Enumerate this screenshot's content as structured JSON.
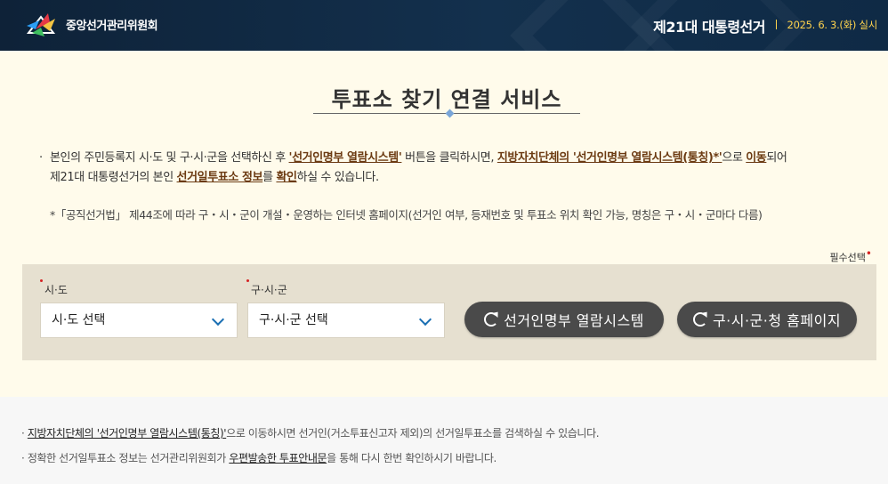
{
  "header": {
    "org_name": "중앙선거관리위원회",
    "election_title": "제21대 대통령선거",
    "election_date": "2025. 6. 3.(화) 실시"
  },
  "main": {
    "title": "투표소 찾기 연결 서비스",
    "desc": {
      "part1": "본인의 주민등록지 시·도 및 구·시·군을 선택하신 후 ",
      "hl1": "'선거인명부 열람시스템'",
      "part2": " 버튼을 클릭하시면, ",
      "hl2": "지방자치단체의 '선거인명부 열람시스템(통칭)*'",
      "part3": "으로 ",
      "hl3": "이동",
      "part4": "되어",
      "part5": "제21대 대통령선거의 본인 ",
      "hl4": "선거일투표소 정보",
      "part6": "를 ",
      "hl5": "확인",
      "part7": "하실 수 있습니다."
    },
    "note": "*「공직선거법」 제44조에 따라 구・시・군이 개설・운영하는 인터넷 홈페이지(선거인 여부, 등재번호 및 투표소 위치 확인 가능, 명칭은 구・시・군마다 다름)",
    "required_label": "필수선택"
  },
  "form": {
    "sido_label": "시·도",
    "sido_value": "시·도 선택",
    "gusigun_label": "구·시·군",
    "gusigun_value": "구·시·군 선택",
    "btn_registry": "선거인명부 열람시스템",
    "btn_homepage": "구·시·군·청 홈페이지"
  },
  "footer": {
    "note1_link": "지방자치단체의 '선거인명부 열람시스템(통칭)'",
    "note1_rest": "으로 이동하시면 선거인(거소투표신고자 제외)의 선거일투표소를 검색하실 수 있습니다.",
    "note2_pre": "정확한 선거일투표소 정보는 선거관리위원회가 ",
    "note2_link": "우편발송한 투표안내문",
    "note2_rest": "을 통해 다시 한번 확인하시기 바랍니다."
  },
  "colors": {
    "header_bg": "#13304d",
    "accent_yellow": "#ffd34d",
    "panel_bg": "#e6e0d0",
    "button_bg": "#4a4a4a",
    "highlight_brown": "#6b3a12"
  }
}
